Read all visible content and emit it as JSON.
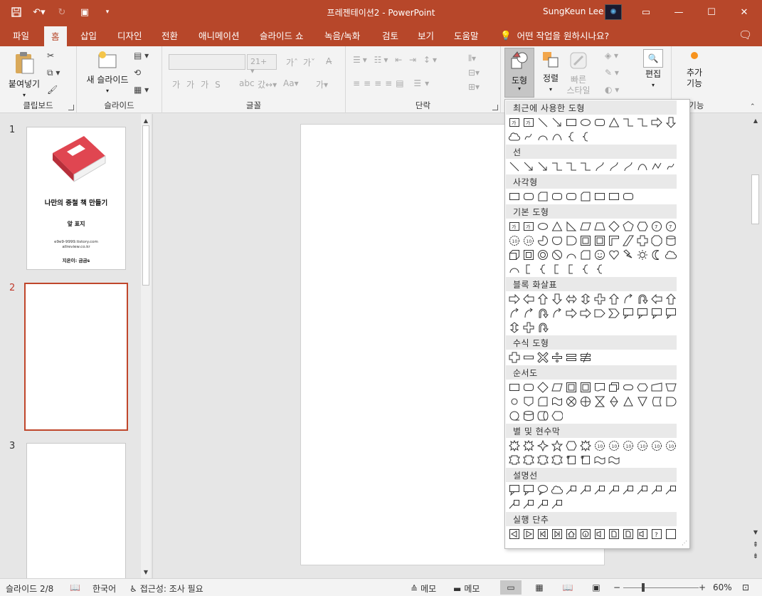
{
  "window": {
    "title": "프레젠테이션2 - PowerPoint",
    "user": "SungKeun Lee",
    "accent": "#b7472a"
  },
  "tabs": [
    "파일",
    "홈",
    "삽입",
    "디자인",
    "전환",
    "애니메이션",
    "슬라이드 쇼",
    "녹음/녹화",
    "검토",
    "보기",
    "도움말"
  ],
  "active_tab": "홈",
  "tell_me": "어떤 작업을 원하시나요?",
  "ribbon": {
    "clipboard": {
      "paste": "붙여넣기",
      "label": "클립보드"
    },
    "slides": {
      "new_slide": "새 슬라이드",
      "label": "슬라이드"
    },
    "font": {
      "font_size": "21+",
      "label": "글꼴"
    },
    "paragraph": {
      "label": "단락"
    },
    "drawing": {
      "shapes": "도형",
      "arrange": "정렬",
      "quick_styles_1": "빠른",
      "quick_styles_2": "스타일"
    },
    "editing": {
      "edit": "편집"
    },
    "addins": {
      "add_1": "추가",
      "add_2": "기능",
      "label_partial": "가 기능"
    }
  },
  "slides": [
    {
      "number": "1",
      "title": "나만의 중철 책 만들기",
      "subtitle": "앞 표지",
      "url1": "e9e9-9999.tistory.com",
      "url2": "allreview.co.kr",
      "author": "지은이: 금금s"
    },
    {
      "number": "2"
    },
    {
      "number": "3"
    }
  ],
  "shape_gallery": {
    "sections": [
      "최근에 사용한 도형",
      "선",
      "사각형",
      "기본 도형",
      "블록 화살표",
      "수식 도형",
      "순서도",
      "별 및 현수막",
      "설명선",
      "실행 단추"
    ]
  },
  "status": {
    "slide_info": "슬라이드 2/8",
    "language": "한국어",
    "accessibility": "접근성: 조사 필요",
    "notes": "메모",
    "comments": "메모",
    "zoom": "60%",
    "zoom_value": 0.6
  }
}
